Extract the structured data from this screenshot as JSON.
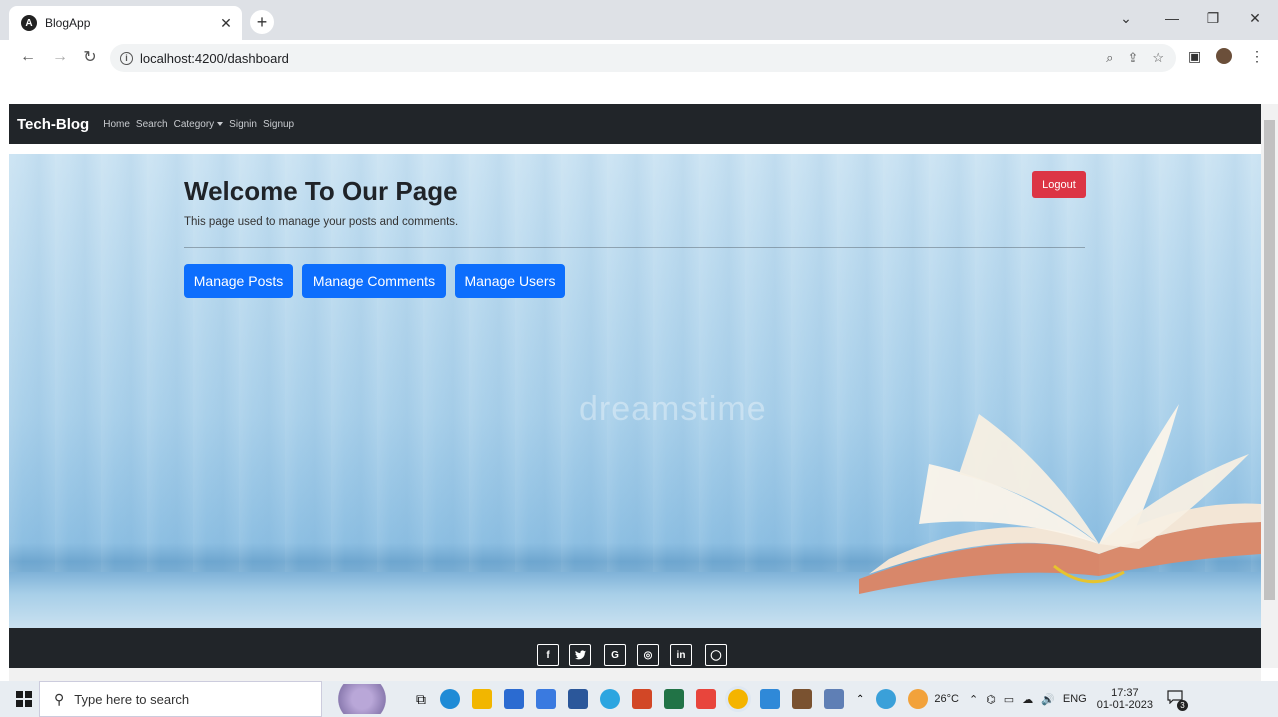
{
  "browser": {
    "tab_title": "BlogApp",
    "tab_favicon": "A",
    "url": "localhost:4200/dashboard"
  },
  "navbar": {
    "brand": "Tech-Blog",
    "links": [
      "Home",
      "Search",
      "Category",
      "Signin",
      "Signup"
    ]
  },
  "hero": {
    "title": "Welcome To Our Page",
    "subtitle": "This page used to manage your posts and comments.",
    "logout_label": "Logout",
    "buttons": [
      "Manage Posts",
      "Manage Comments",
      "Manage Users"
    ],
    "watermark": "dreamstime"
  },
  "footer": {
    "social_icons": [
      "facebook-icon",
      "twitter-icon",
      "google-icon",
      "instagram-icon",
      "linkedin-icon",
      "github-icon"
    ],
    "social_glyphs": [
      "f",
      "🐦",
      "G",
      "◎",
      "in",
      "◯"
    ]
  },
  "taskbar": {
    "search_placeholder": "Type here to search",
    "temperature": "26°C",
    "language": "ENG",
    "time": "17:37",
    "date": "01-01-2023",
    "notification_count": "3"
  },
  "colors": {
    "navbar_bg": "#212529",
    "primary": "#0d6efd",
    "danger": "#dc3545"
  }
}
